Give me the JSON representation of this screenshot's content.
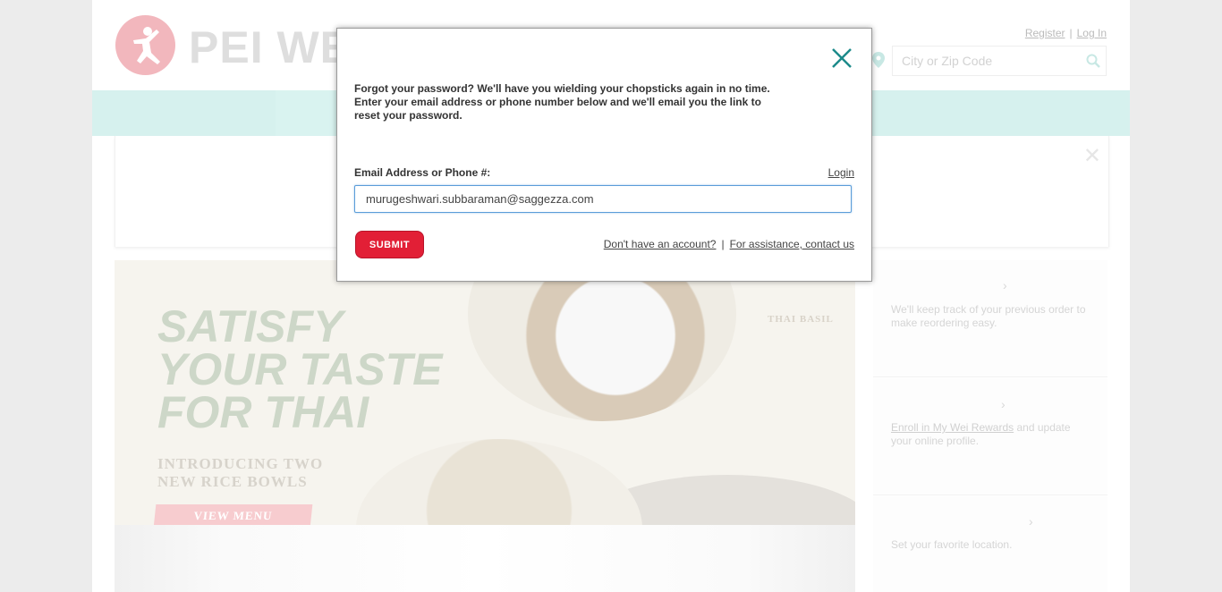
{
  "header": {
    "logo_text": "PEI WEI",
    "register_label": "Register",
    "login_label": "Log In",
    "separator": "|",
    "search_placeholder": "City or Zip Code"
  },
  "hero": {
    "title": "SATISFY\nYOUR TASTE\nFOR THAI",
    "subtitle": "INTRODUCING TWO\nNEW RICE BOWLS",
    "tag": "THAI BASIL",
    "cta_label": "VIEW MENU"
  },
  "side_cards": [
    {
      "chevron": "›",
      "text": "We'll keep track of your previous order to make reordering easy."
    },
    {
      "chevron": "›",
      "link_text": "Enroll in My Wei Rewards",
      "text": " and update your online profile."
    },
    {
      "chevron": "›",
      "text": "Set your favorite location."
    }
  ],
  "modal": {
    "message": "Forgot your password? We'll have you wielding your chopsticks again in no time. Enter your email address or phone number below and we'll email you the link to reset your password.",
    "field_label": "Email Address or Phone #:",
    "login_link": "Login",
    "email_value": "murugeshwari.subbaraman@saggezza.com",
    "submit_label": "SUBMIT",
    "no_account_link": "Don't have an account?",
    "footer_separator": "|",
    "assistance_link": "For assistance, contact us"
  },
  "colors": {
    "brand_red": "#e21f36",
    "teal_close": "#1c8a8a",
    "nav_band": "#d6f1ee"
  },
  "icons": [
    "logo-dancer-icon",
    "location-pin-icon",
    "search-icon",
    "close-icon",
    "notice-close-icon",
    "chevron-right-icon"
  ]
}
